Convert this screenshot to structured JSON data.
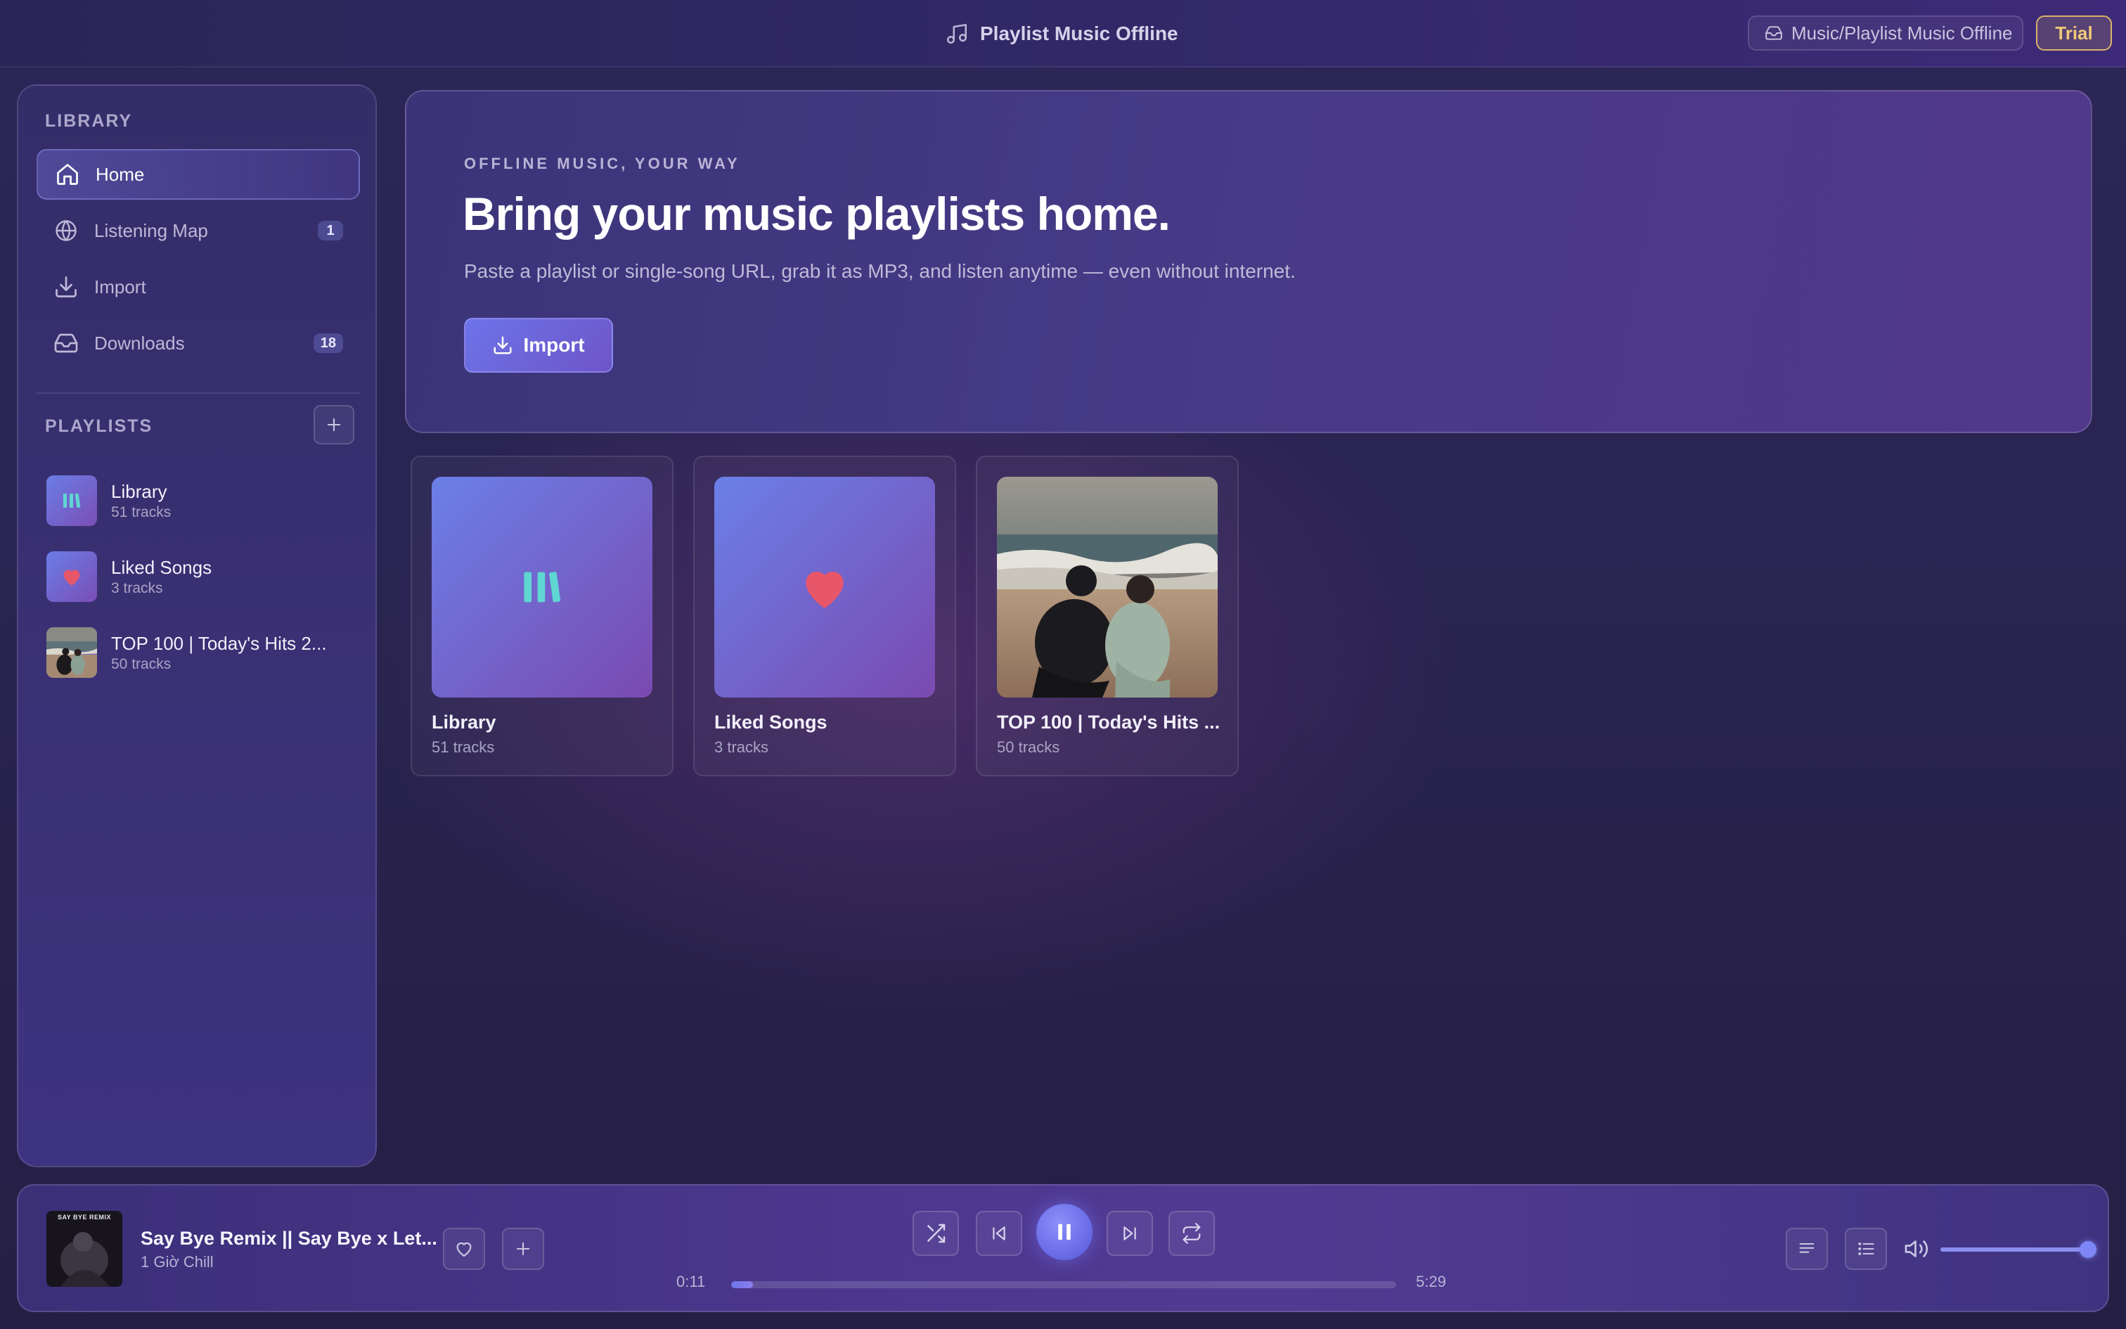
{
  "header": {
    "app_title": "Playlist Music Offline",
    "path_chip": "Music/Playlist Music Offline",
    "trial_badge": "Trial"
  },
  "sidebar": {
    "library_label": "LIBRARY",
    "nav": [
      {
        "label": "Home",
        "icon": "home-icon",
        "active": true,
        "badge": ""
      },
      {
        "label": "Listening Map",
        "icon": "globe-icon",
        "active": false,
        "badge": "1"
      },
      {
        "label": "Import",
        "icon": "download-icon",
        "active": false,
        "badge": ""
      },
      {
        "label": "Downloads",
        "icon": "inbox-icon",
        "active": false,
        "badge": "18"
      }
    ],
    "playlists_label": "PLAYLISTS",
    "playlists": [
      {
        "name": "Library",
        "count": "51 tracks",
        "art": "bars-icon"
      },
      {
        "name": "Liked Songs",
        "count": "3 tracks",
        "art": "heart-icon"
      },
      {
        "name": "TOP 100 | Today's Hits 2...",
        "count": "50 tracks",
        "art": "beach-photo"
      }
    ]
  },
  "hero": {
    "eyebrow": "OFFLINE MUSIC, YOUR WAY",
    "title": "Bring your music playlists home.",
    "subtitle": "Paste a playlist or single-song URL, grab it as MP3, and listen anytime — even without internet.",
    "import_label": "Import"
  },
  "cards": [
    {
      "title": "Library",
      "count": "51 tracks",
      "art": "bars-icon"
    },
    {
      "title": "Liked Songs",
      "count": "3 tracks",
      "art": "heart-icon"
    },
    {
      "title": "TOP 100 | Today's Hits ...",
      "count": "50 tracks",
      "art": "beach-photo"
    }
  ],
  "player": {
    "cover_text": "SAY BYE REMIX",
    "track_title": "Say Bye Remix || Say Bye x Let...",
    "artist": "1 Giờ Chill",
    "elapsed": "0:11",
    "duration": "5:29",
    "progress_fraction": 0.033,
    "volume_fraction": 1.0,
    "is_playing": true
  },
  "colors": {
    "accent": "#6c74e8",
    "heart": "#e8566a",
    "bars": "#5fd6d2",
    "trial": "#f0c978"
  }
}
